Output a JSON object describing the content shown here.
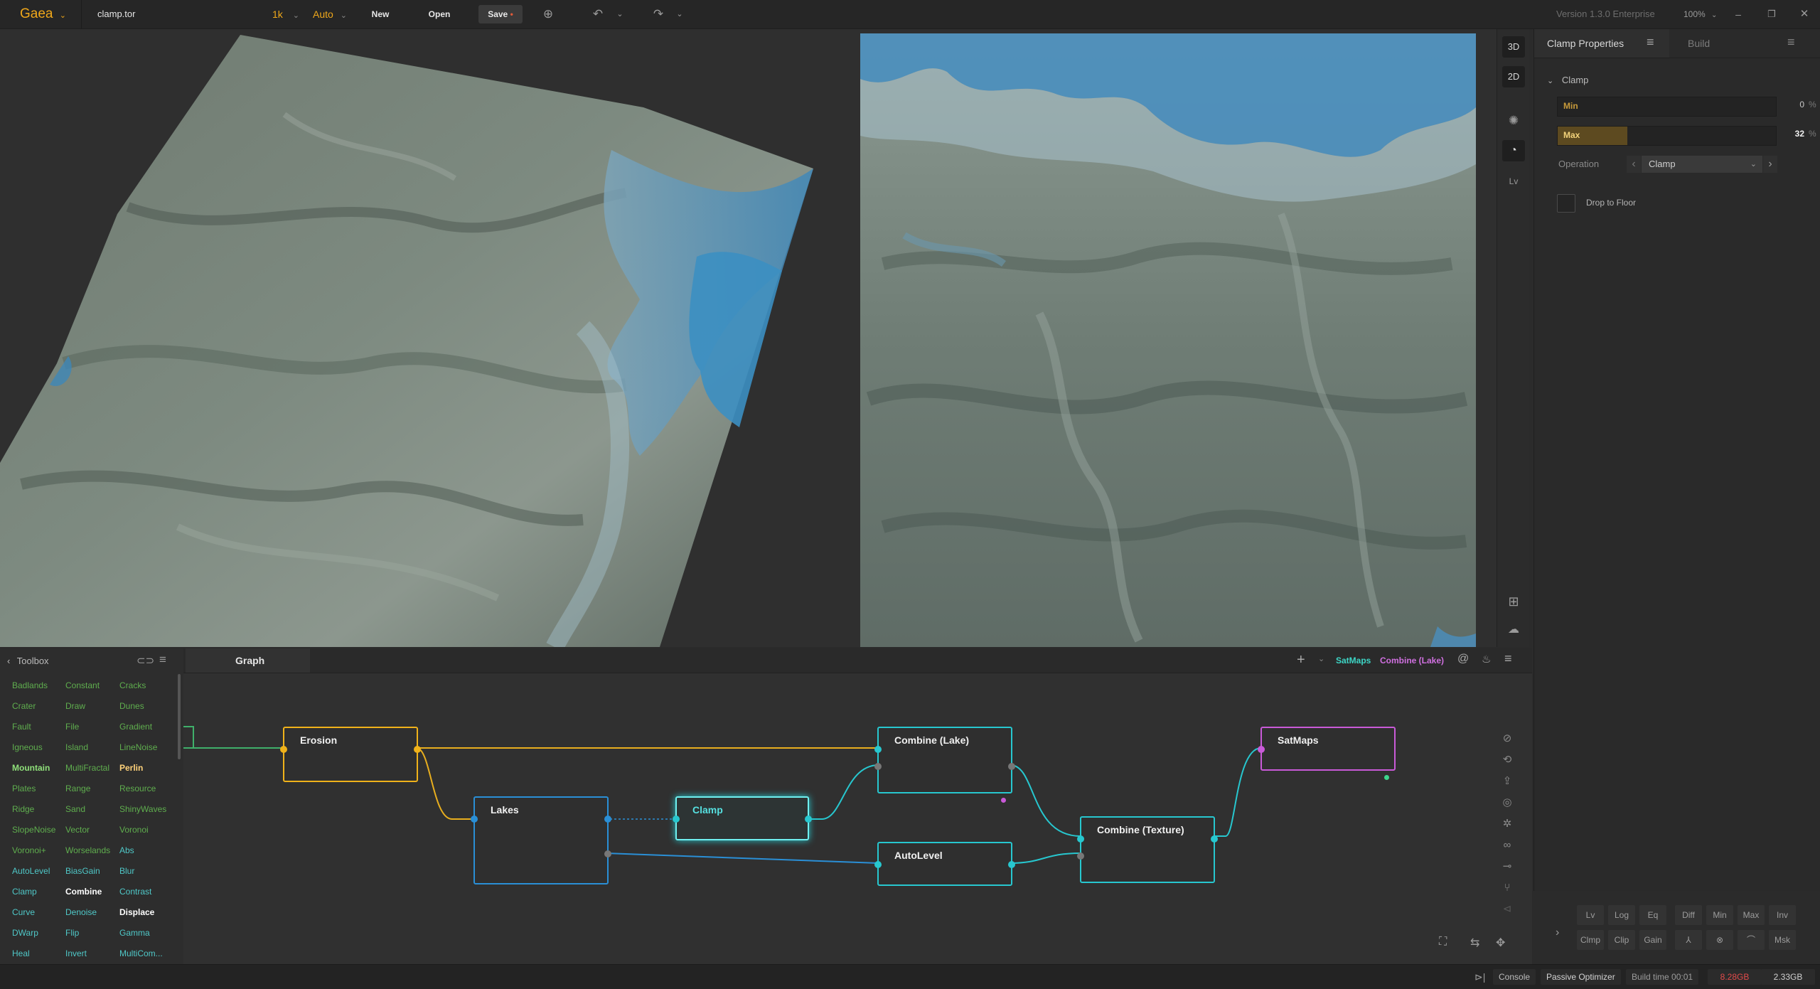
{
  "topbar": {
    "app_name": "Gaea",
    "file_name": "clamp.tor",
    "resolution": "1k",
    "build_mode": "Auto",
    "new_label": "New",
    "open_label": "Open",
    "save_label": "Save",
    "version": "Version 1.3.0 Enterprise",
    "zoom": "100%"
  },
  "viewport_tools": {
    "view_3d": "3D",
    "view_2d": "2D",
    "lv": "Lv"
  },
  "properties": {
    "tab_title": "Clamp Properties",
    "tab_build": "Build",
    "section": "Clamp",
    "min_label": "Min",
    "min_value": "0",
    "min_unit": "%",
    "max_label": "Max",
    "max_value": "32",
    "max_unit": "%",
    "max_fraction": 0.32,
    "operation_label": "Operation",
    "operation_value": "Clamp",
    "drop_to_floor": "Drop to Floor",
    "buttons_row1": [
      "Lv",
      "Log",
      "Eq",
      "Diff",
      "Min",
      "Max",
      "Inv"
    ],
    "buttons_row2": [
      "Clmp",
      "Clip",
      "Gain",
      "⅄",
      "⊗",
      "⌒",
      "Msk"
    ]
  },
  "toolbox": {
    "title": "Toolbox",
    "items": [
      [
        "Badlands",
        "Constant",
        "Cracks"
      ],
      [
        "Crater",
        "Draw",
        "Dunes"
      ],
      [
        "Fault",
        "File",
        "Gradient"
      ],
      [
        "Igneous",
        "Island",
        "LineNoise"
      ],
      [
        "Mountain",
        "MultiFractal",
        "Perlin"
      ],
      [
        "Plates",
        "Range",
        "Resource"
      ],
      [
        "Ridge",
        "Sand",
        "ShinyWaves"
      ],
      [
        "SlopeNoise",
        "Vector",
        "Voronoi"
      ],
      [
        "Voronoi+",
        "Worselands",
        "Abs"
      ],
      [
        "AutoLevel",
        "BiasGain",
        "Blur"
      ],
      [
        "Clamp",
        "Combine",
        "Contrast"
      ],
      [
        "Curve",
        "Denoise",
        "Displace"
      ],
      [
        "DWarp",
        "Flip",
        "Gamma"
      ],
      [
        "Heal",
        "Invert",
        "MultiCom..."
      ]
    ]
  },
  "graph": {
    "tab": "Graph",
    "satmaps_link": "SatMaps",
    "combine_lake_link": "Combine (Lake)",
    "nodes": {
      "erosion": "Erosion",
      "lakes": "Lakes",
      "clamp": "Clamp",
      "combine_lake": "Combine (Lake)",
      "autolevel": "AutoLevel",
      "combine_texture": "Combine (Texture)",
      "satmaps": "SatMaps"
    }
  },
  "status": {
    "console": "Console",
    "passive_optimizer": "Passive Optimizer",
    "build_time": "Build time 00:01",
    "memory_used": "8.28GB",
    "memory_other": "2.33GB"
  },
  "colors": {
    "accent_orange": "#f0a81a",
    "node_yellow": "#f0b21a",
    "node_blue": "#2a8fd6",
    "node_cyan": "#27c7cf",
    "node_magenta": "#c95ad8",
    "toolbox_green": "#5fae4e",
    "toolbox_cyan": "#4fc8c8"
  }
}
